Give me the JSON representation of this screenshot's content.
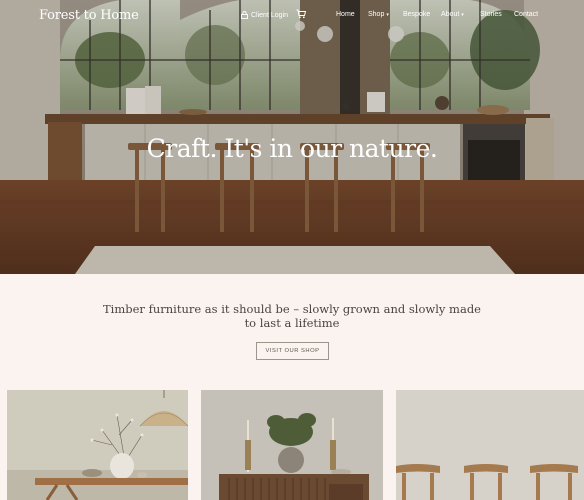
{
  "brand": {
    "logo": "Forest to Home"
  },
  "nav": {
    "client_login": "Client Login",
    "items": [
      {
        "label": "Home"
      },
      {
        "label": "Shop",
        "has_dropdown": true
      },
      {
        "label": "Bespoke"
      },
      {
        "label": "About",
        "has_dropdown": true
      },
      {
        "label": "Stories"
      },
      {
        "label": "Contact"
      }
    ]
  },
  "hero": {
    "title": "Craft. It's in our nature."
  },
  "intro": {
    "tagline": "Timber furniture as it should be – slowly grown and slowly made to last a lifetime",
    "cta_label": "VISIT OUR SHOP"
  },
  "colors": {
    "page_bg": "#faf3ef",
    "text_dark": "#4a4540",
    "white": "#ffffff"
  },
  "cards": [
    {
      "name": "dining-table-with-pendant-lamp"
    },
    {
      "name": "sideboard-with-plant"
    },
    {
      "name": "wooden-stools"
    }
  ]
}
